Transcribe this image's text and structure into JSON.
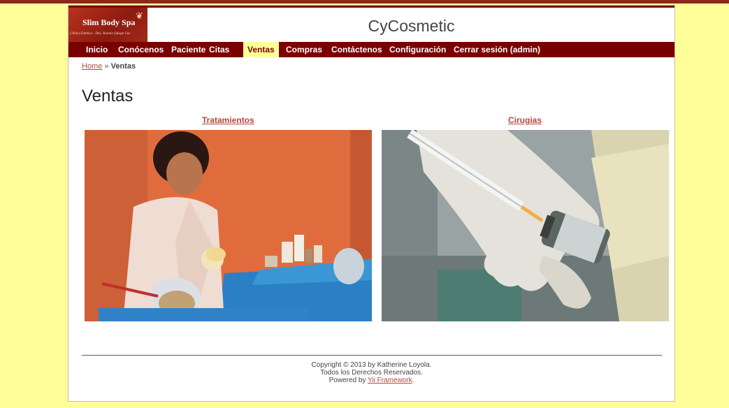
{
  "header": {
    "logo_title": "Slim Body Spa",
    "logo_subtitle": "Clínica Estética - Dra. Yesenia Quispe Cuc",
    "site_title": "CyCosmetic"
  },
  "nav": [
    {
      "label": "Inicio"
    },
    {
      "label": "Conócenos"
    },
    {
      "label": "Paciente"
    },
    {
      "label": "Citas"
    },
    {
      "label": "Ventas",
      "active": true
    },
    {
      "label": "Compras"
    },
    {
      "label": "Contáctenos"
    },
    {
      "label": "Configuración"
    },
    {
      "label": "Cerrar sesión (admin)"
    }
  ],
  "breadcrumb": {
    "home": "Home",
    "separator": "»",
    "current": "Ventas"
  },
  "page_title": "Ventas",
  "categories": [
    {
      "label": "Tratamientos",
      "image": "facial-treatment-photo"
    },
    {
      "label": "Cirugias",
      "image": "syringe-vial-photo"
    }
  ],
  "footer": {
    "line1": "Copyright © 2013 by Katherine Loyola.",
    "line2": "Todos los Derechos Reservados.",
    "powered_prefix": "Powered by",
    "powered_link": "Yii Framework",
    "powered_suffix": "."
  },
  "colors": {
    "background": "#ffff99",
    "nav": "#7a0000",
    "link": "#b04a3a"
  }
}
